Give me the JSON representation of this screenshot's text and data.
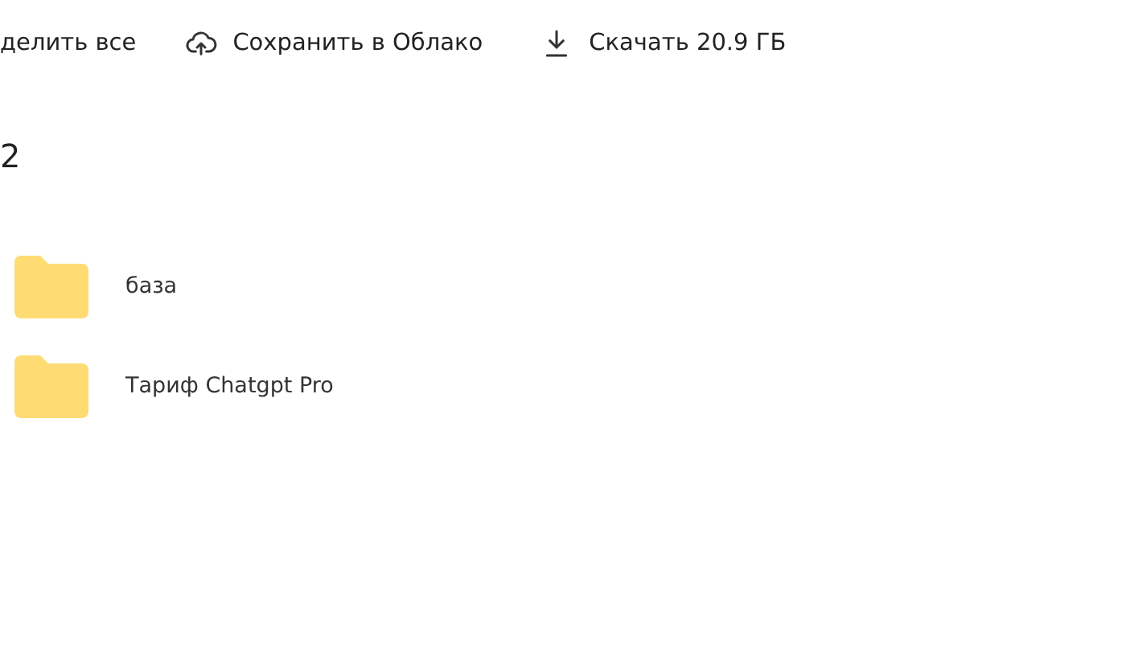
{
  "toolbar": [
    {
      "kind": "plain",
      "label": "делить все"
    },
    {
      "kind": "upload",
      "label": "Сохранить в Облако"
    },
    {
      "kind": "download",
      "label": "Скачать 20.9 ГБ"
    }
  ],
  "heading": "2",
  "items": [
    {
      "kind": "folder",
      "name": "база"
    },
    {
      "kind": "folder",
      "name": "Тариф Chatgpt Pro"
    }
  ]
}
